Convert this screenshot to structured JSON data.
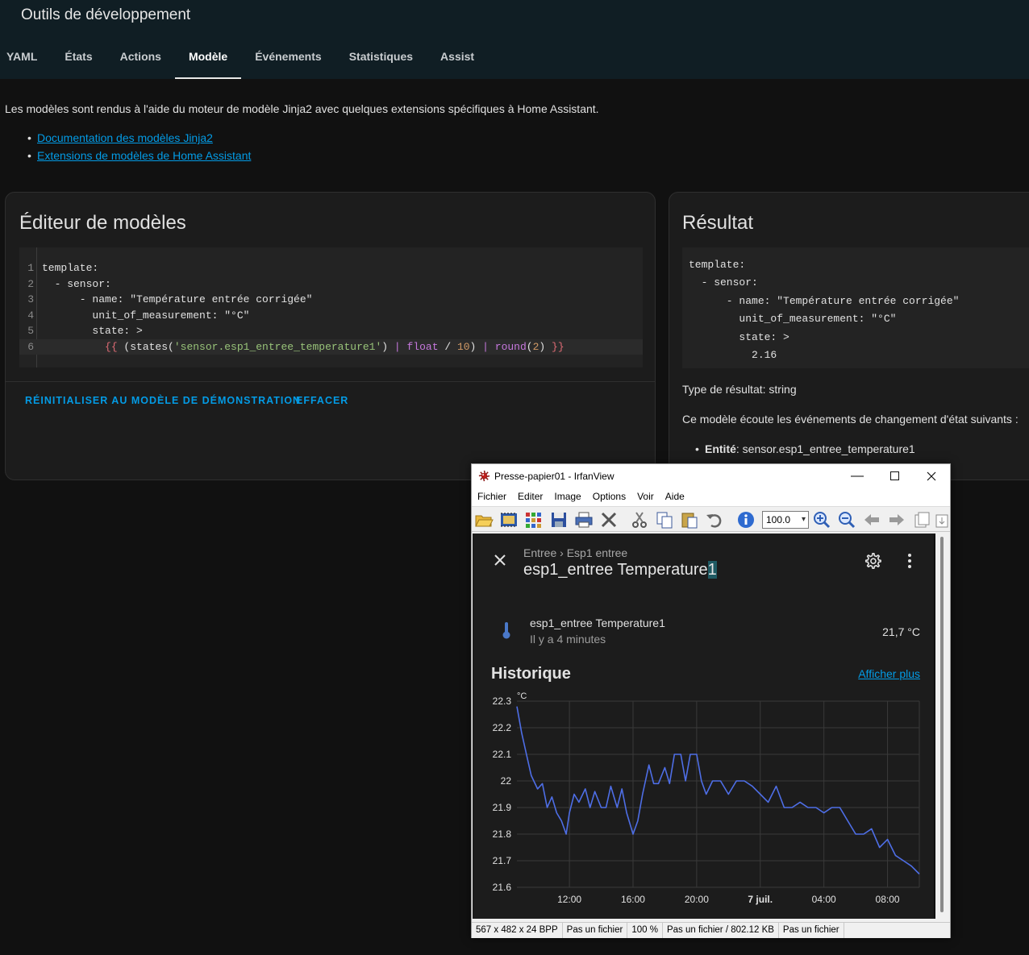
{
  "header": {
    "title": "Outils de développement",
    "tabs": [
      {
        "label": "YAML"
      },
      {
        "label": "États"
      },
      {
        "label": "Actions"
      },
      {
        "label": "Modèle"
      },
      {
        "label": "Événements"
      },
      {
        "label": "Statistiques"
      },
      {
        "label": "Assist"
      }
    ],
    "active_tab": "Modèle"
  },
  "intro": {
    "text": "Les modèles sont rendus à l'aide du moteur de modèle Jinja2 avec quelques extensions spécifiques à Home Assistant.",
    "links": [
      {
        "label": "Documentation des modèles Jinja2"
      },
      {
        "label": "Extensions de modèles de Home Assistant"
      }
    ]
  },
  "editor_card": {
    "title": "Éditeur de modèles",
    "lines": [
      {
        "n": "1",
        "text": "template:"
      },
      {
        "n": "2",
        "text": "  - sensor:"
      },
      {
        "n": "3",
        "text": "      - name: \"Température entrée corrigée\""
      },
      {
        "n": "4",
        "text": "        unit_of_measurement: \"°C\""
      },
      {
        "n": "5",
        "text": "        state: >"
      },
      {
        "n": "6",
        "text": "          {{ (states('sensor.esp1_entree_temperature1') | float / 10) | round(2) }}"
      }
    ],
    "reset_label": "RÉINITIALISER AU MODÈLE DE DÉMONSTRATION",
    "clear_label": "EFFACER"
  },
  "result_card": {
    "title": "Résultat",
    "output": "template:\n  - sensor:\n      - name: \"Température entrée corrigée\"\n        unit_of_measurement: \"°C\"\n        state: >\n          2.16",
    "result_type": "Type de résultat: string",
    "listen_text": "Ce modèle écoute les événements de changement d'état suivants :",
    "entity_label": "Entité",
    "entity_value": ": sensor.esp1_entree_temperature1"
  },
  "irfanview": {
    "title": "Presse-papier01 - IrfanView",
    "menu": [
      "Fichier",
      "Editer",
      "Image",
      "Options",
      "Voir",
      "Aide"
    ],
    "zoom": "100.0",
    "status": [
      "567 x 482 x 24 BPP",
      "Pas un fichier",
      "100 %",
      "Pas un fichier / 802.12 KB",
      "Pas un fichier"
    ],
    "dialog": {
      "breadcrumb": "Entree › Esp1 entree",
      "title_main": "esp1_entree Temperature",
      "title_cursor": "1",
      "entity_name": "esp1_entree Temperature1",
      "entity_time": "Il y a 4 minutes",
      "entity_value": "21,7 °C",
      "history_label": "Historique",
      "more_label": "Afficher plus"
    }
  },
  "chart_data": {
    "type": "line",
    "unit_label": "°C",
    "ylim": [
      21.6,
      22.3
    ],
    "y_ticks": [
      "22.3",
      "22.2",
      "22.1",
      "22",
      "21.9",
      "21.8",
      "21.7",
      "21.6"
    ],
    "x_ticks": [
      "12:00",
      "16:00",
      "20:00",
      "7 juil.",
      "04:00",
      "08:00"
    ],
    "x_ticks_bold": [
      false,
      false,
      false,
      true,
      false,
      false
    ],
    "grid": true,
    "color": "#4e6ee6",
    "series": [
      {
        "x": [
          8.7,
          9.0,
          9.3,
          9.6,
          10.0,
          10.3,
          10.6,
          10.9,
          11.2,
          11.5,
          11.8,
          12.0,
          12.3,
          12.6,
          13.0,
          13.3,
          13.6,
          14.0,
          14.3,
          14.6,
          15.0,
          15.3,
          15.6,
          16.0,
          16.3,
          16.6,
          17.0,
          17.3,
          17.6,
          18.0,
          18.3,
          18.6,
          19.0,
          19.3,
          19.6,
          20.0,
          20.3,
          20.6,
          21.0,
          21.5,
          22.0,
          22.5,
          23.0,
          23.5,
          24.0,
          24.5,
          25.0,
          25.5,
          26.0,
          26.5,
          27.0,
          27.5,
          28.0,
          28.5,
          29.0,
          29.5,
          30.0,
          30.5,
          31.0,
          31.5,
          32.0,
          32.5,
          33.0,
          33.5,
          34.0
        ],
        "y": [
          22.28,
          22.18,
          22.1,
          22.02,
          21.97,
          21.99,
          21.9,
          21.94,
          21.88,
          21.85,
          21.8,
          21.88,
          21.95,
          21.92,
          21.97,
          21.9,
          21.96,
          21.9,
          21.9,
          21.98,
          21.9,
          21.97,
          21.88,
          21.8,
          21.85,
          21.95,
          22.06,
          21.99,
          21.99,
          22.05,
          21.99,
          22.1,
          22.1,
          22.0,
          22.1,
          22.1,
          22.0,
          21.95,
          22.0,
          22.0,
          21.95,
          22.0,
          22.0,
          21.98,
          21.95,
          21.92,
          21.98,
          21.9,
          21.9,
          21.92,
          21.9,
          21.9,
          21.88,
          21.9,
          21.9,
          21.85,
          21.8,
          21.8,
          21.82,
          21.75,
          21.78,
          21.72,
          21.7,
          21.68,
          21.65
        ]
      }
    ]
  }
}
